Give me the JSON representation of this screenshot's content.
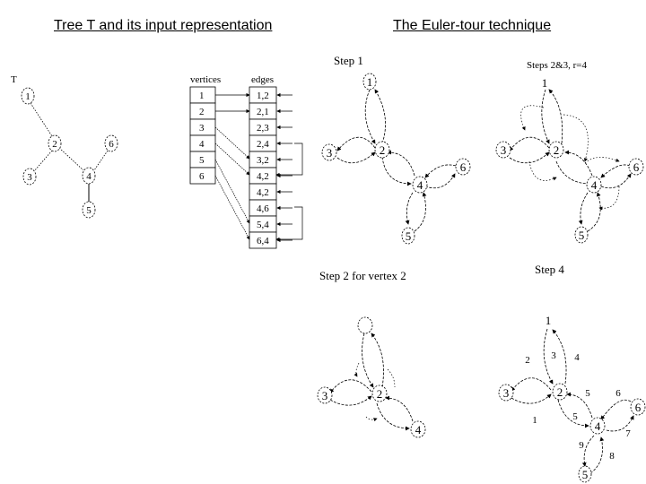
{
  "titles": {
    "left": "Tree T and its input representation",
    "right": "The Euler-tour technique"
  },
  "tree": {
    "label": "T",
    "vertices": [
      "1",
      "2",
      "3",
      "4",
      "5",
      "6"
    ],
    "edges": [
      [
        "1",
        "2"
      ],
      [
        "2",
        "3"
      ],
      [
        "2",
        "4"
      ],
      [
        "4",
        "5"
      ],
      [
        "4",
        "6"
      ]
    ]
  },
  "table": {
    "vertices_header": "vertices",
    "edges_header": "edges",
    "vertices": [
      "1",
      "2",
      "3",
      "4",
      "5",
      "6"
    ],
    "edges": [
      "1,2",
      "2,1",
      "2,3",
      "2,4",
      "3,2",
      "4,2",
      "4,2",
      "4,6",
      "5,4",
      "6,4"
    ]
  },
  "panels": {
    "step1": {
      "label": "Step 1"
    },
    "steps23": {
      "label": "Steps 2&3, r=4"
    },
    "step2v2": {
      "label": "Step 2 for vertex 2"
    },
    "step4": {
      "label": "Step 4",
      "edge_numbers": [
        "1",
        "2",
        "3",
        "4",
        "5",
        "6",
        "7",
        "8",
        "9",
        "5"
      ]
    }
  },
  "node_labels": {
    "n1": "1",
    "n2": "2",
    "n3": "3",
    "n4": "4",
    "n5": "5",
    "n6": "6"
  }
}
